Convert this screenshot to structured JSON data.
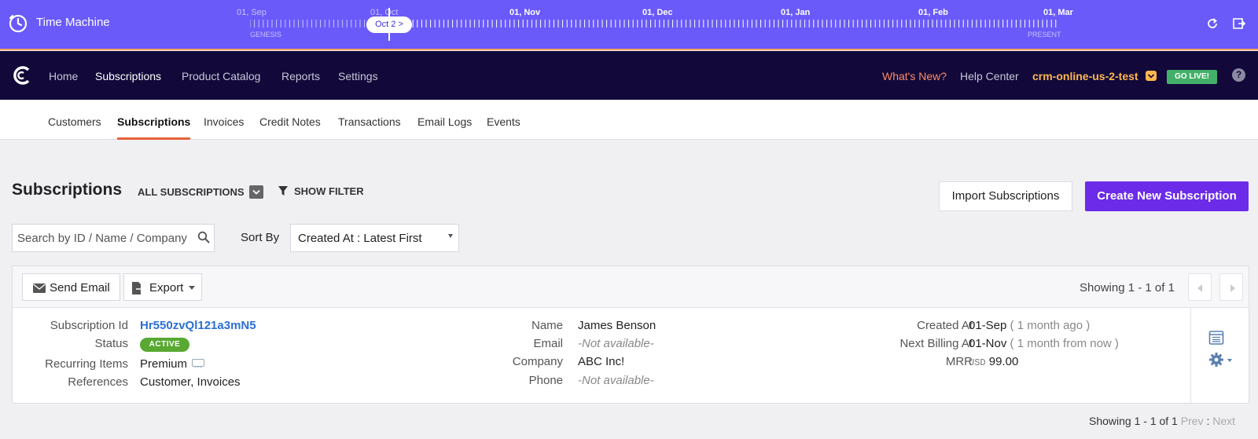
{
  "time_machine": {
    "title": "Time Machine",
    "months": [
      "01, Sep",
      "01, Oct",
      "01, Nov",
      "01, Dec",
      "01, Jan",
      "01, Feb",
      "01, Mar"
    ],
    "genesis_label": "GENESIS",
    "present_label": "PRESENT",
    "current_date": "Oct 2 >"
  },
  "nav": {
    "items": [
      "Home",
      "Subscriptions",
      "Product Catalog",
      "Reports",
      "Settings"
    ],
    "active": "Subscriptions",
    "whats_new": "What's New?",
    "help_center": "Help Center",
    "site": "crm-online-us-2-test",
    "go_live": "GO LIVE!",
    "help_icon": "?"
  },
  "subnav": {
    "items": [
      "Customers",
      "Subscriptions",
      "Invoices",
      "Credit Notes",
      "Transactions",
      "Email Logs",
      "Events"
    ],
    "active": "Subscriptions"
  },
  "header": {
    "title": "Subscriptions",
    "view": "ALL SUBSCRIPTIONS",
    "show_filter": "SHOW FILTER",
    "import_label": "Import Subscriptions",
    "create_label": "Create New Subscription"
  },
  "search": {
    "placeholder": "Search by ID / Name / Company",
    "value": ""
  },
  "sort": {
    "label": "Sort By",
    "value": "Created At : Latest First"
  },
  "toolbar": {
    "send_email": "Send Email",
    "export": "Export",
    "showing": "Showing 1 - 1 of 1"
  },
  "subscription": {
    "labels": {
      "id": "Subscription Id",
      "status": "Status",
      "recurring": "Recurring Items",
      "references": "References",
      "name": "Name",
      "email": "Email",
      "company": "Company",
      "phone": "Phone",
      "created": "Created At",
      "next_billing": "Next Billing At",
      "mrr": "MRR"
    },
    "id": "Hr550zvQl121a3mN5",
    "status": "ACTIVE",
    "recurring": "Premium",
    "references": "Customer, Invoices",
    "name": "James Benson",
    "email": "-Not available-",
    "company": "ABC Inc!",
    "phone": "-Not available-",
    "created_date": "01-Sep",
    "created_rel": "( 1 month ago )",
    "next_billing_date": "01-Nov",
    "next_billing_rel": "( 1 month from now )",
    "mrr_currency": "USD",
    "mrr_value": "99.00"
  },
  "footer": {
    "showing": "Showing 1 - 1 of 1",
    "prev": "Prev",
    "separator": ":",
    "next": "Next"
  },
  "colors": {
    "time_machine_bg": "#6a5af9",
    "nav_bg": "#12093a",
    "accent_orange": "#e8623a",
    "primary_purple": "#6b2be8",
    "active_green": "#58a832",
    "link_blue": "#2c6fd1"
  }
}
